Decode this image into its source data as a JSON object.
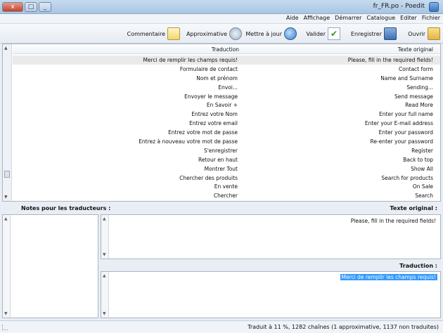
{
  "window": {
    "title": "fr_FR.po - Poedit",
    "controls": {
      "close": "x",
      "maximize": "□",
      "minimize": "_"
    }
  },
  "menu": [
    "Fichier",
    "Editer",
    "Catalogue",
    "Démarrer",
    "Affichage",
    "Aide"
  ],
  "toolbar": {
    "open": "Ouvrir",
    "save": "Enregistrer",
    "validate": "Valider",
    "update": "Mettre à jour",
    "approx": "Approximative",
    "comment": "Commentaire"
  },
  "list": {
    "headers": {
      "source": "Texte original",
      "translation": "Traduction"
    },
    "rows": [
      {
        "source": "Please, fill in the required fields!",
        "translation": "Merci de remplir les champs requis!"
      },
      {
        "source": "Contact form",
        "translation": "Formulaire de contact"
      },
      {
        "source": "Name and Surname",
        "translation": "Nom et prénom"
      },
      {
        "source": "Sending...",
        "translation": "Envoi..."
      },
      {
        "source": "Send message",
        "translation": "Envoyer le message"
      },
      {
        "source": "Read More",
        "translation": "En Savoir +"
      },
      {
        "source": "Enter your full name",
        "translation": "Entrez votre Nom"
      },
      {
        "source": "Enter your E-mail address",
        "translation": "Entrez votre email"
      },
      {
        "source": "Enter your password",
        "translation": "Entrez votre mot de passe"
      },
      {
        "source": "Re-enter your password",
        "translation": "Entrez à nouveau votre mot de passe"
      },
      {
        "source": "Register",
        "translation": "S'enregistrer"
      },
      {
        "source": "Back to top",
        "translation": "Retour en haut"
      },
      {
        "source": "Show All",
        "translation": "Montrer Tout"
      },
      {
        "source": "Search for products",
        "translation": "Chercher des produits"
      },
      {
        "source": "On Sale",
        "translation": "En vente"
      },
      {
        "source": "Search",
        "translation": "Chercher"
      }
    ]
  },
  "panels": {
    "notes_label": "Notes pour les traducteurs :",
    "original_label": "Texte original :",
    "original_text": "Please, fill in the required fields!",
    "translation_label": "Traduction :",
    "translation_text": "Merci de remplir les champs requis!"
  },
  "status": "Traduit à 11 %, 1282 chaînes (1 approximative, 1137 non traduites)"
}
